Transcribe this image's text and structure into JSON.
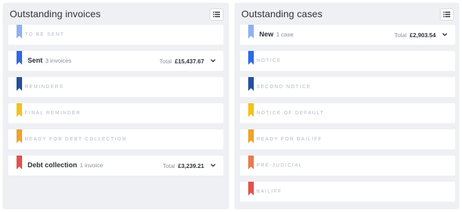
{
  "invoices": {
    "title": "Outstanding invoices",
    "list_icon": "list-icon",
    "rows": [
      {
        "label": "TO BE SENT",
        "color": "#8fb0f0",
        "expanded": false
      },
      {
        "label": "Sent",
        "count": "3 invoices",
        "total_label": "Total",
        "total": "£15,437.67",
        "color": "#2f6ae0",
        "expanded": true
      },
      {
        "label": "REMINDERS",
        "color": "#234f9c",
        "expanded": false
      },
      {
        "label": "FINAL REMINDER",
        "color": "#f3c21b",
        "expanded": false
      },
      {
        "label": "READY FOR DEBT COLLECTION",
        "color": "#f0a22a",
        "expanded": false
      },
      {
        "label": "Debt collection",
        "count": "1 invoice",
        "total_label": "Total",
        "total": "£3,239.21",
        "color": "#e4514b",
        "expanded": true
      }
    ]
  },
  "cases": {
    "title": "Outstanding cases",
    "list_icon": "list-icon",
    "rows": [
      {
        "label": "New",
        "count": "1 case",
        "total_label": "Total",
        "total": "£2,903.54",
        "color": "#8fb0f0",
        "expanded": true
      },
      {
        "label": "NOTICE",
        "color": "#2f6ae0",
        "expanded": false
      },
      {
        "label": "SECOND NOTICE",
        "color": "#234f9c",
        "expanded": false
      },
      {
        "label": "NOTICE OF DEFAULT",
        "color": "#f3c21b",
        "expanded": false
      },
      {
        "label": "READY FOR BAILIFF",
        "color": "#f0a22a",
        "expanded": false
      },
      {
        "label": "PRE-JUDICIAL",
        "color": "#ea7a4a",
        "expanded": false
      },
      {
        "label": "BAILIFF",
        "color": "#e4514b",
        "expanded": false
      }
    ]
  }
}
